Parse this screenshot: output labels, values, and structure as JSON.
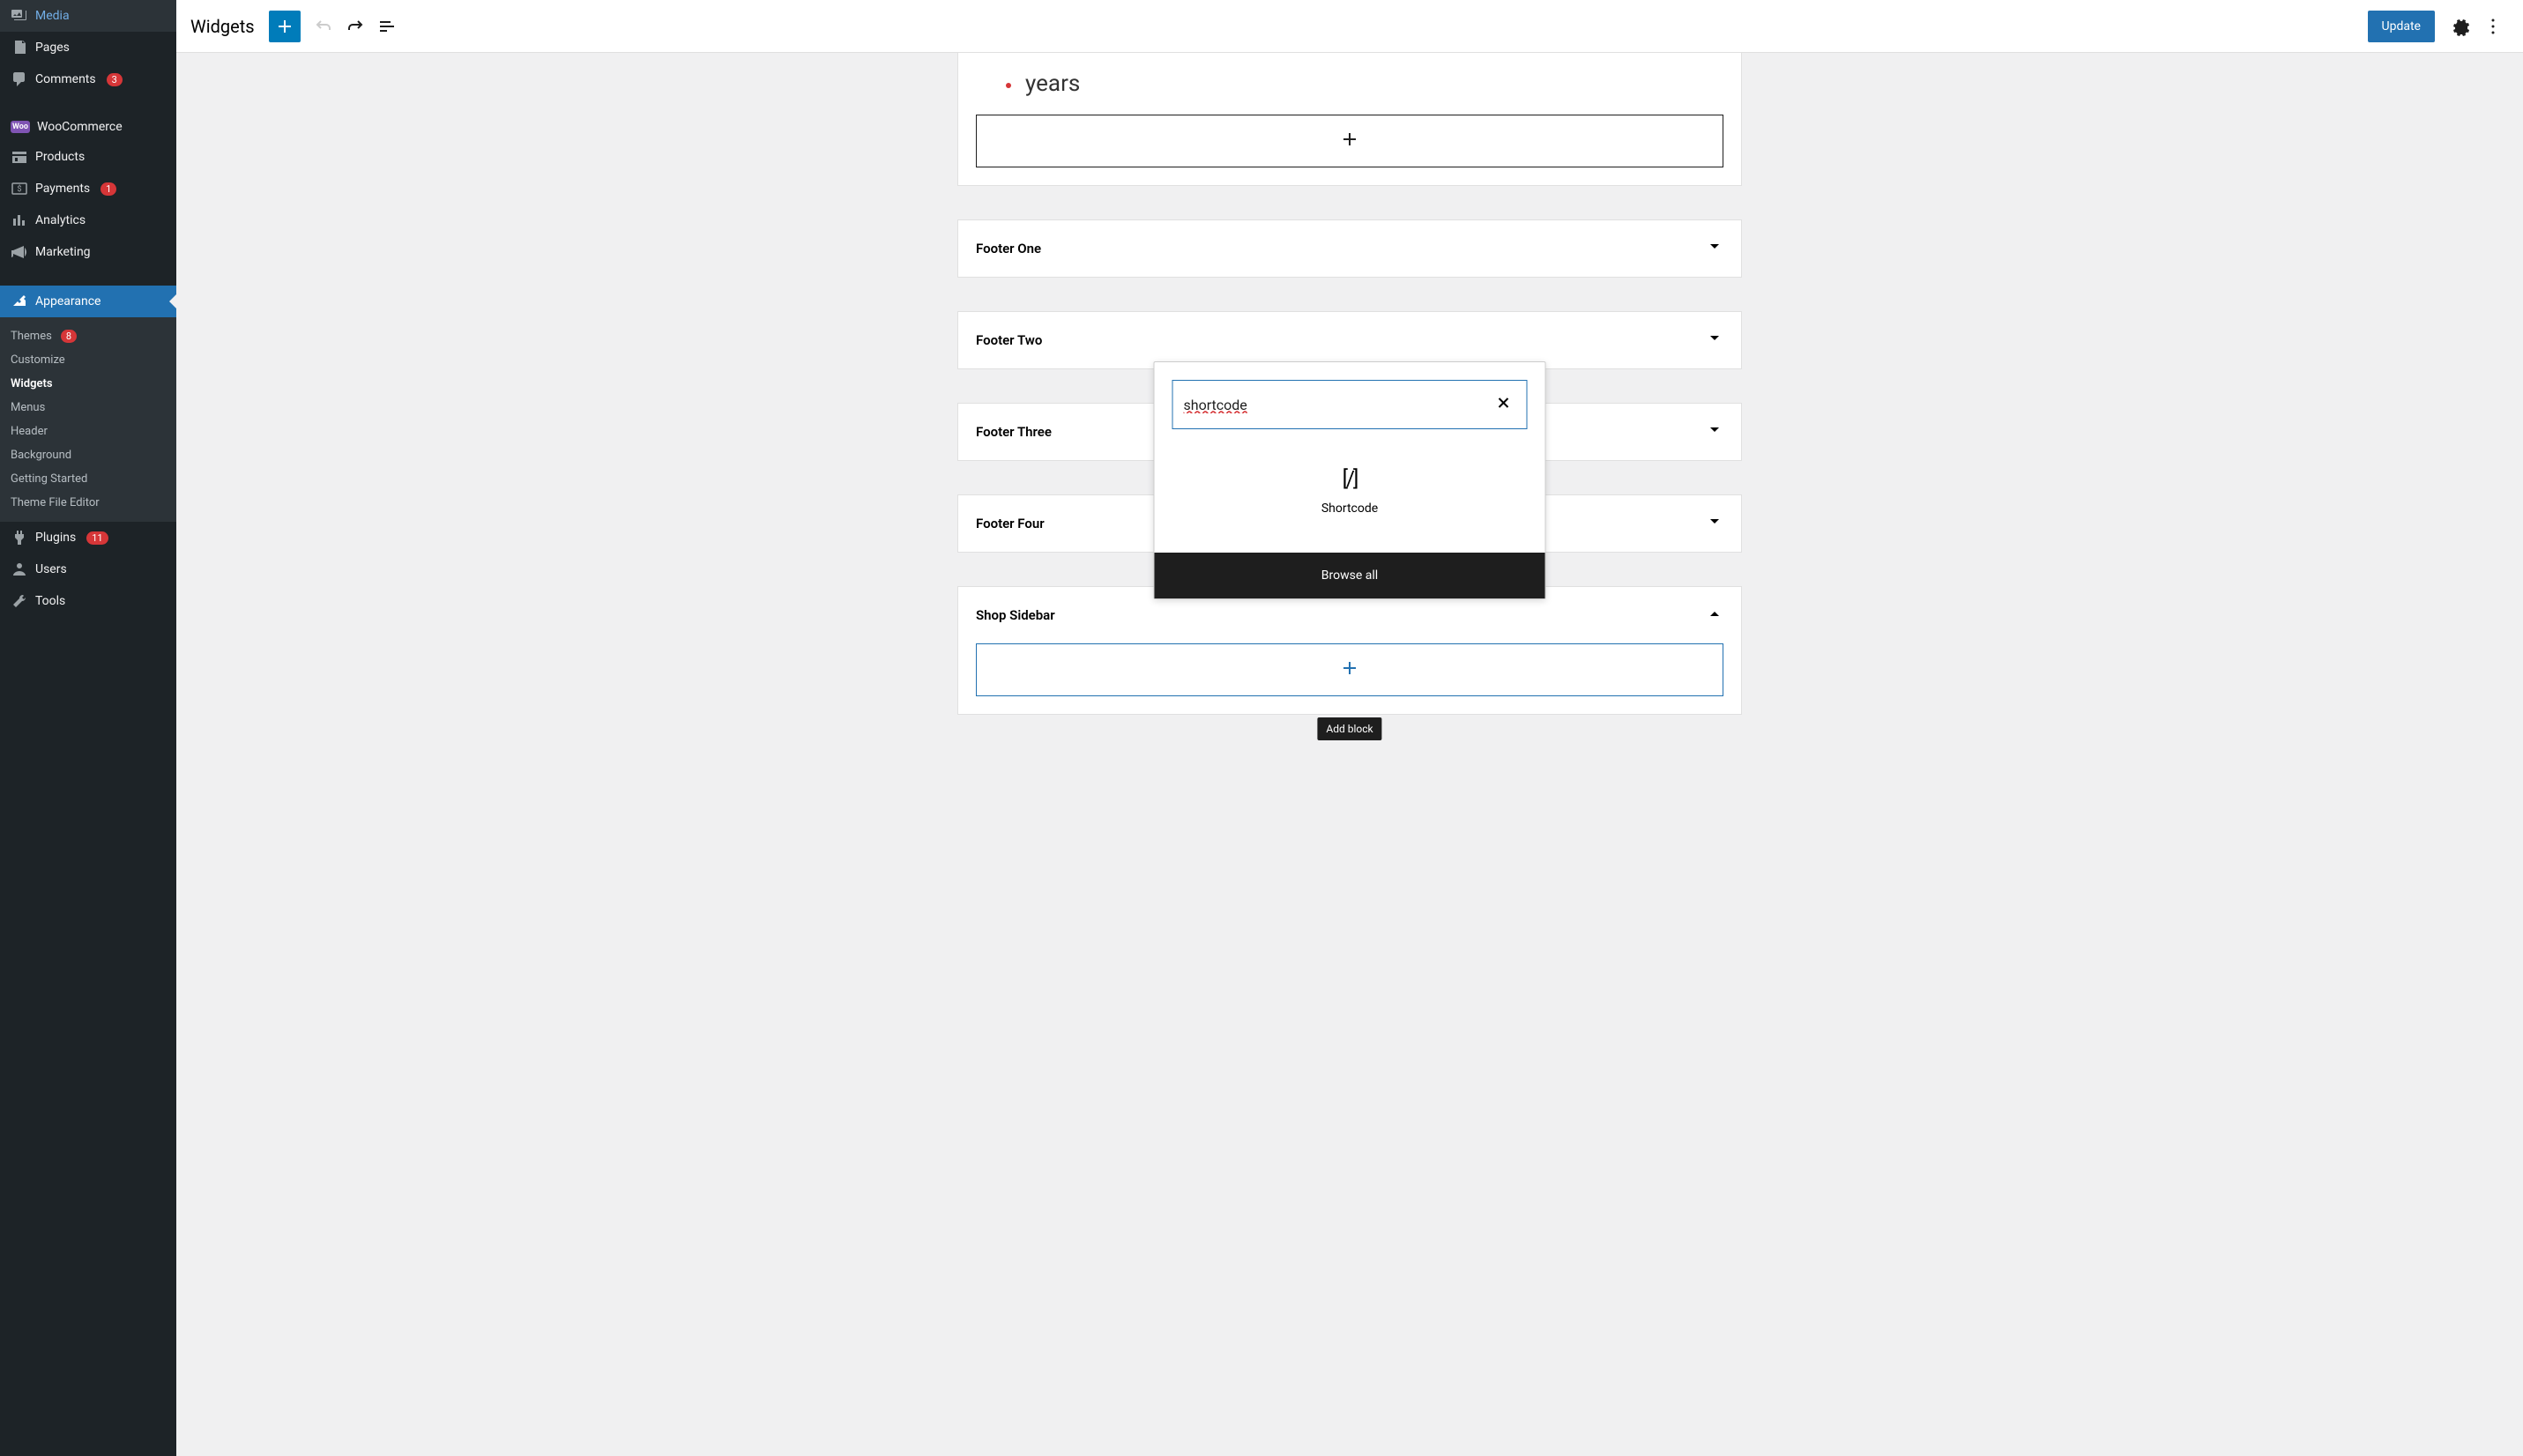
{
  "sidebar": {
    "items": [
      {
        "label": "Media",
        "icon": "media"
      },
      {
        "label": "Pages",
        "icon": "pages"
      },
      {
        "label": "Comments",
        "icon": "comments",
        "badge": "3"
      },
      {
        "label": "WooCommerce",
        "icon": "woo"
      },
      {
        "label": "Products",
        "icon": "products"
      },
      {
        "label": "Payments",
        "icon": "payments",
        "badge": "1"
      },
      {
        "label": "Analytics",
        "icon": "analytics"
      },
      {
        "label": "Marketing",
        "icon": "marketing"
      },
      {
        "label": "Appearance",
        "icon": "appearance",
        "active": true
      },
      {
        "label": "Plugins",
        "icon": "plugins",
        "badge": "11"
      },
      {
        "label": "Users",
        "icon": "users"
      },
      {
        "label": "Tools",
        "icon": "tools"
      }
    ],
    "appearance_submenu": [
      {
        "label": "Themes",
        "badge": "8"
      },
      {
        "label": "Customize"
      },
      {
        "label": "Widgets",
        "current": true
      },
      {
        "label": "Menus"
      },
      {
        "label": "Header"
      },
      {
        "label": "Background"
      },
      {
        "label": "Getting Started"
      },
      {
        "label": "Theme File Editor"
      }
    ]
  },
  "topbar": {
    "title": "Widgets",
    "update_label": "Update"
  },
  "content": {
    "text_fragment": "years",
    "panels": [
      {
        "title": "Footer One"
      },
      {
        "title": "Footer Two"
      },
      {
        "title": "Footer Three"
      },
      {
        "title": "Footer Four"
      },
      {
        "title": "Shop Sidebar",
        "expanded": true
      }
    ]
  },
  "inserter": {
    "search_value": "shortcode",
    "results": [
      {
        "label": "Shortcode",
        "icon": "[/]"
      }
    ],
    "browse_all_label": "Browse all"
  },
  "tooltip": {
    "add_block": "Add block"
  }
}
